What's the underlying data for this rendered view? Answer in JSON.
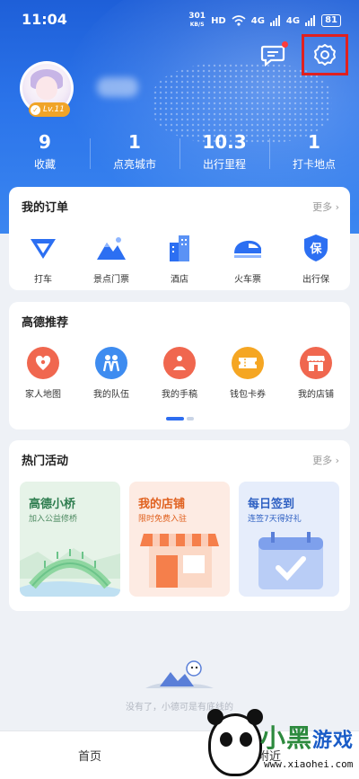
{
  "status_bar": {
    "time": "11:04",
    "net_speed": "301",
    "net_unit": "KB/S",
    "hd": "HD",
    "sig1": "4G",
    "sig2": "4G",
    "battery": "81"
  },
  "header": {
    "message_icon": "message-icon",
    "settings_icon": "gear-icon",
    "level": "Lv.11"
  },
  "stats": [
    {
      "value": "9",
      "label": "收藏"
    },
    {
      "value": "1",
      "label": "点亮城市"
    },
    {
      "value": "10.3",
      "label": "出行里程"
    },
    {
      "value": "1",
      "label": "打卡地点"
    }
  ],
  "orders": {
    "title": "我的订单",
    "more": "更多",
    "items": [
      {
        "label": "打车",
        "icon": "taxi-icon"
      },
      {
        "label": "景点门票",
        "icon": "mountain-icon"
      },
      {
        "label": "酒店",
        "icon": "hotel-icon"
      },
      {
        "label": "火车票",
        "icon": "train-icon"
      },
      {
        "label": "出行保",
        "icon": "shield-icon"
      }
    ]
  },
  "recommend": {
    "title": "高德推荐",
    "items": [
      {
        "label": "家人地图",
        "icon": "family-map-icon",
        "color": "#f0674f"
      },
      {
        "label": "我的队伍",
        "icon": "team-icon",
        "color": "#3e8cf0"
      },
      {
        "label": "我的手稿",
        "icon": "manuscript-icon",
        "color": "#f0674f"
      },
      {
        "label": "钱包卡券",
        "icon": "coupon-icon",
        "color": "#f5a623"
      },
      {
        "label": "我的店铺",
        "icon": "shop-icon",
        "color": "#f0674f"
      }
    ]
  },
  "activities": {
    "title": "热门活动",
    "more": "更多",
    "items": [
      {
        "title": "高德小桥",
        "subtitle": "加入公益修桥",
        "bg": "#e6f3e8",
        "color": "#2e7d4f"
      },
      {
        "title": "我的店铺",
        "subtitle": "限时免费入驻",
        "bg": "#fdebe3",
        "color": "#e0611f"
      },
      {
        "title": "每日签到",
        "subtitle": "连签7天得好礼",
        "bg": "#e6edfb",
        "color": "#2d5fc2"
      }
    ]
  },
  "empty_text": "没有了，小德可是有底线的",
  "tabs": [
    {
      "label": "首页"
    },
    {
      "label": "附近"
    }
  ],
  "watermark": {
    "brand": "小黑",
    "brand2": "游戏",
    "url": "www.xiaohei.com"
  }
}
